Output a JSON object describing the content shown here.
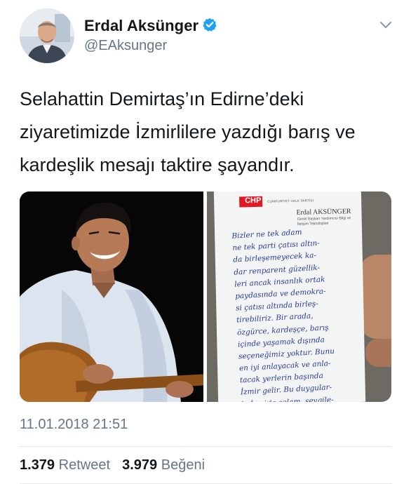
{
  "author": {
    "name": "Erdal Aksünger",
    "handle": "@EAksunger",
    "verified": true,
    "avatar_icon": "profile-photo"
  },
  "tweet": {
    "text_lines": [
      "Selahattin Demirtaş’ın Edirne’deki",
      "ziyaretimizde İzmirlilere yazdığı barış ve",
      "kardeşlik mesajı taktire şayandır."
    ],
    "timestamp": "11.01.2018 21:51"
  },
  "media": {
    "left_photo": "man-playing-saz-photo",
    "right_photo": {
      "letterhead_logo": "CHP",
      "letterhead_party": "CUMHURİYET HALK PARTİSİ",
      "letterhead_name": "Erdal AKSÜNGER",
      "letterhead_title": "Genel Başkan Yardımcısı Bilgi ve İletişim Teknolojileri",
      "handwritten_lines": [
        "Bizler ne tek adam",
        "ne tek parti çatısı altın-",
        "da birleşemeyecek ka-",
        "dar renparent güzellik-",
        "leri ancak insanlık ortak",
        "paydasında ve demokra-",
        "si çatısı altında birleş-",
        "tirebiliriz. Bir arada,",
        "özgürce, kardeşçe, barış",
        "içinde yaşamak dışında",
        "seçeneğimiz yoktur. Bunu",
        "en iyi anlayacak ve anla-",
        "tacak yerlerin başında",
        "İzmir gelir. Bu duygular-",
        "la İzmir'e selam, sevgile-"
      ]
    }
  },
  "stats": {
    "retweets_count": "1.379",
    "retweets_label": "Retweet",
    "likes_count": "3.979",
    "likes_label": "Beğeni"
  },
  "colors": {
    "text": "#14171a",
    "secondary": "#657786",
    "verified_blue": "#1da1f2",
    "chp_red": "#e11a22",
    "ink_blue": "#283a9a"
  }
}
